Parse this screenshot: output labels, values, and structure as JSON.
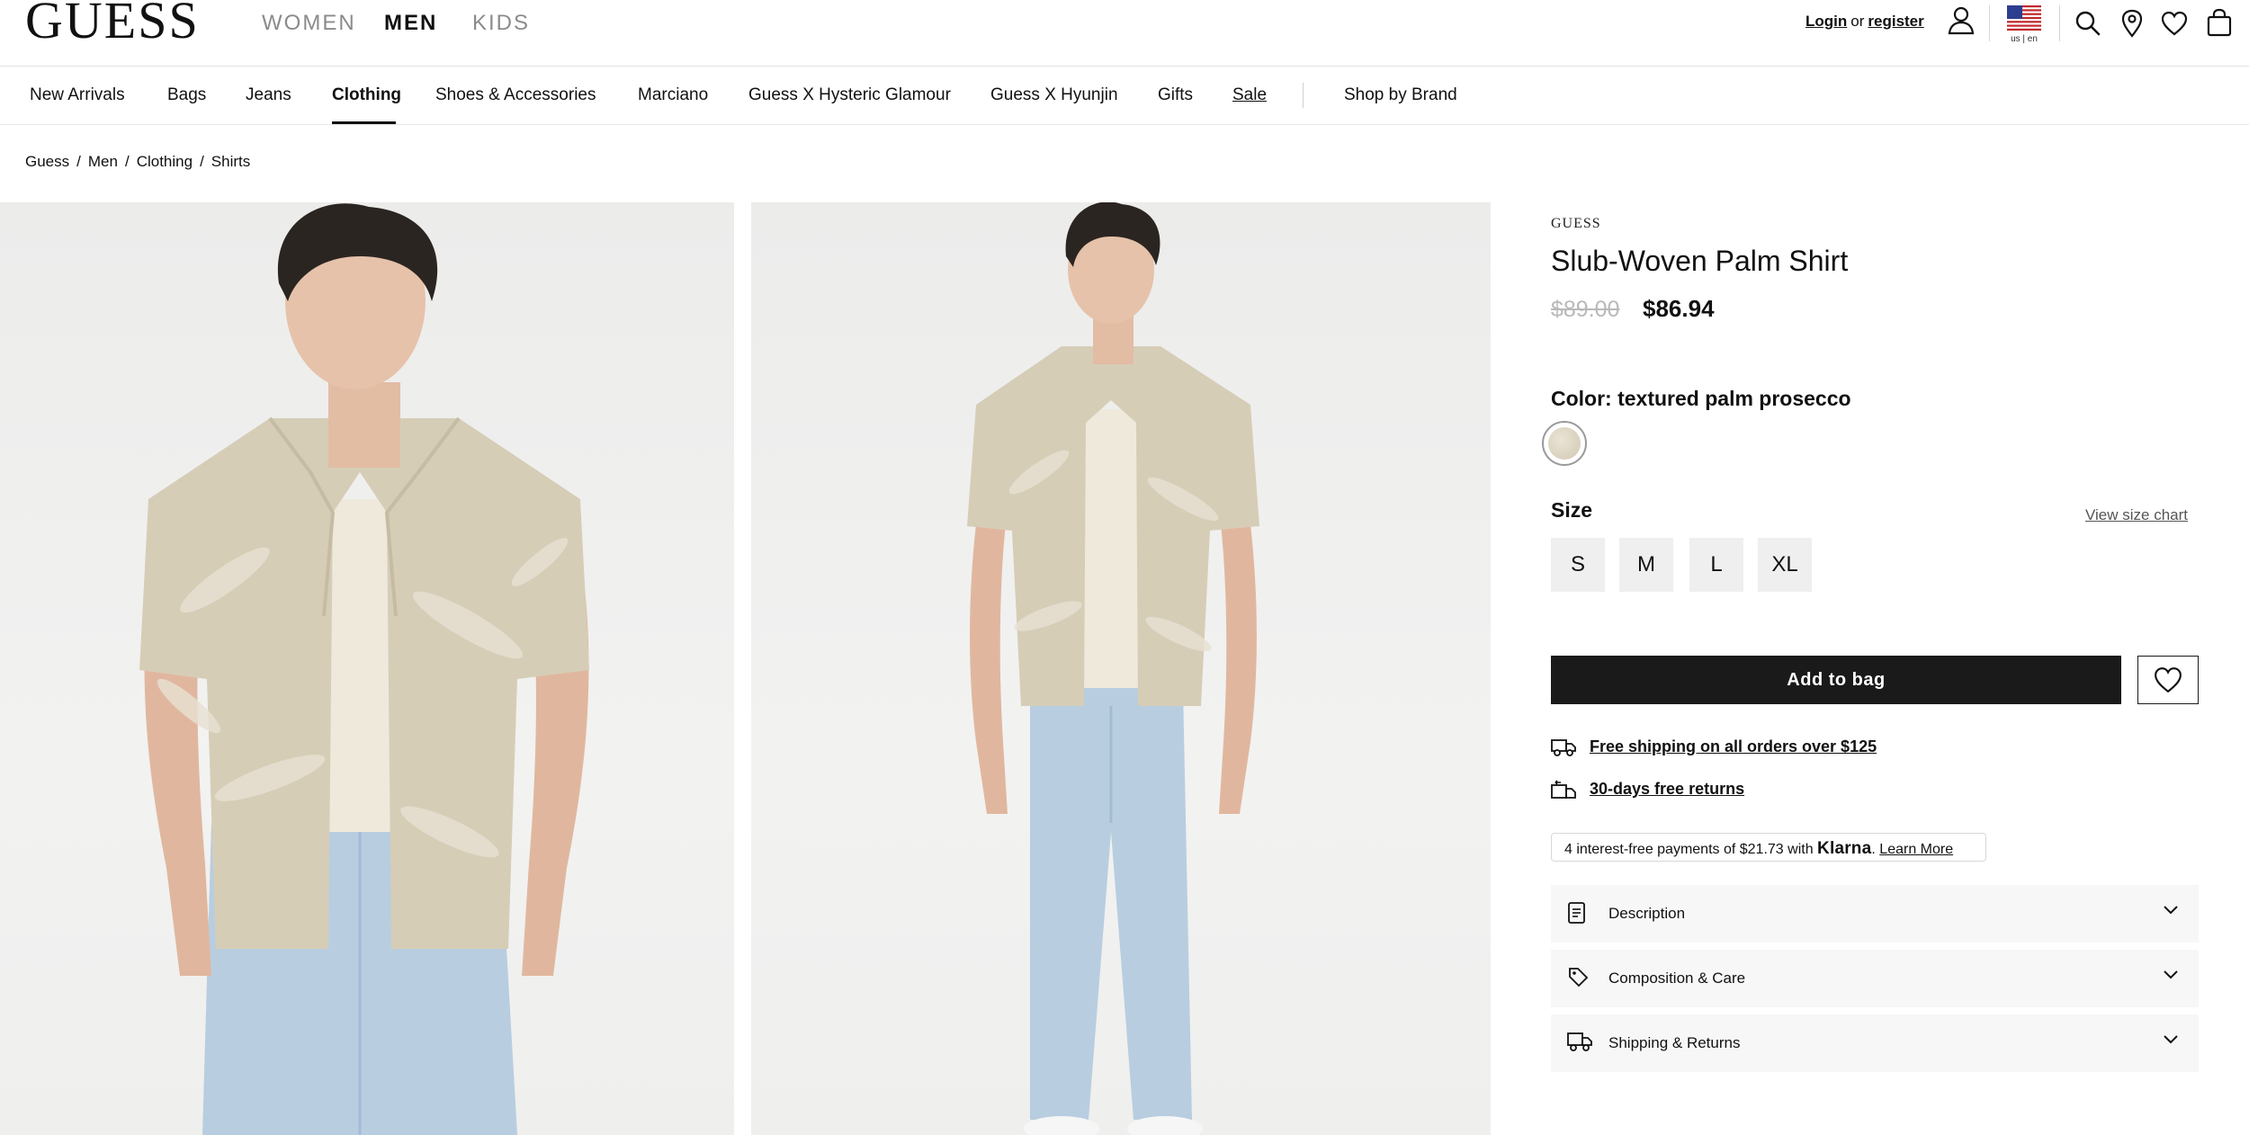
{
  "header": {
    "logo": "GUESS",
    "gender_tabs": [
      {
        "label": "WOMEN",
        "active": false
      },
      {
        "label": "MEN",
        "active": true
      },
      {
        "label": "KIDS",
        "active": false
      }
    ],
    "login": "Login",
    "or": "or",
    "register": "register",
    "locale": "us | en"
  },
  "categories": [
    {
      "label": "New Arrivals"
    },
    {
      "label": "Bags"
    },
    {
      "label": "Jeans"
    },
    {
      "label": "Clothing",
      "active": true
    },
    {
      "label": "Shoes & Accessories"
    },
    {
      "label": "Marciano"
    },
    {
      "label": "Guess X Hysteric Glamour"
    },
    {
      "label": "Guess X Hyunjin"
    },
    {
      "label": "Gifts"
    },
    {
      "label": "Sale"
    },
    {
      "label": "Shop by Brand"
    }
  ],
  "breadcrumb": [
    "Guess",
    "Men",
    "Clothing",
    "Shirts"
  ],
  "product": {
    "brand": "GUESS",
    "title": "Slub-Woven Palm Shirt",
    "price_original": "$89.00",
    "price_sale": "$86.94",
    "color_label": "Color: textured palm prosecco",
    "size_label": "Size",
    "size_chart_link": "View size chart",
    "sizes": [
      "S",
      "M",
      "L",
      "XL"
    ],
    "add_to_bag": "Add to bag",
    "perks": [
      {
        "icon": "truck-icon",
        "text": "Free shipping on all orders over $125"
      },
      {
        "icon": "returns-icon",
        "text": "30-days free returns"
      }
    ],
    "klarna": {
      "prefix": "4 interest-free payments of $21.73 with ",
      "brand": "Klarna",
      "suffix": ".",
      "learn_more": "Learn More"
    },
    "accordions": [
      {
        "icon": "document-icon",
        "label": "Description"
      },
      {
        "icon": "tag-icon",
        "label": "Composition & Care"
      },
      {
        "icon": "delivery-truck-icon",
        "label": "Shipping & Returns"
      }
    ]
  },
  "colors": {
    "primary_button": "#1a1a1a",
    "muted_price": "#b9b9b9",
    "accordion_bg": "#f7f7f7"
  }
}
